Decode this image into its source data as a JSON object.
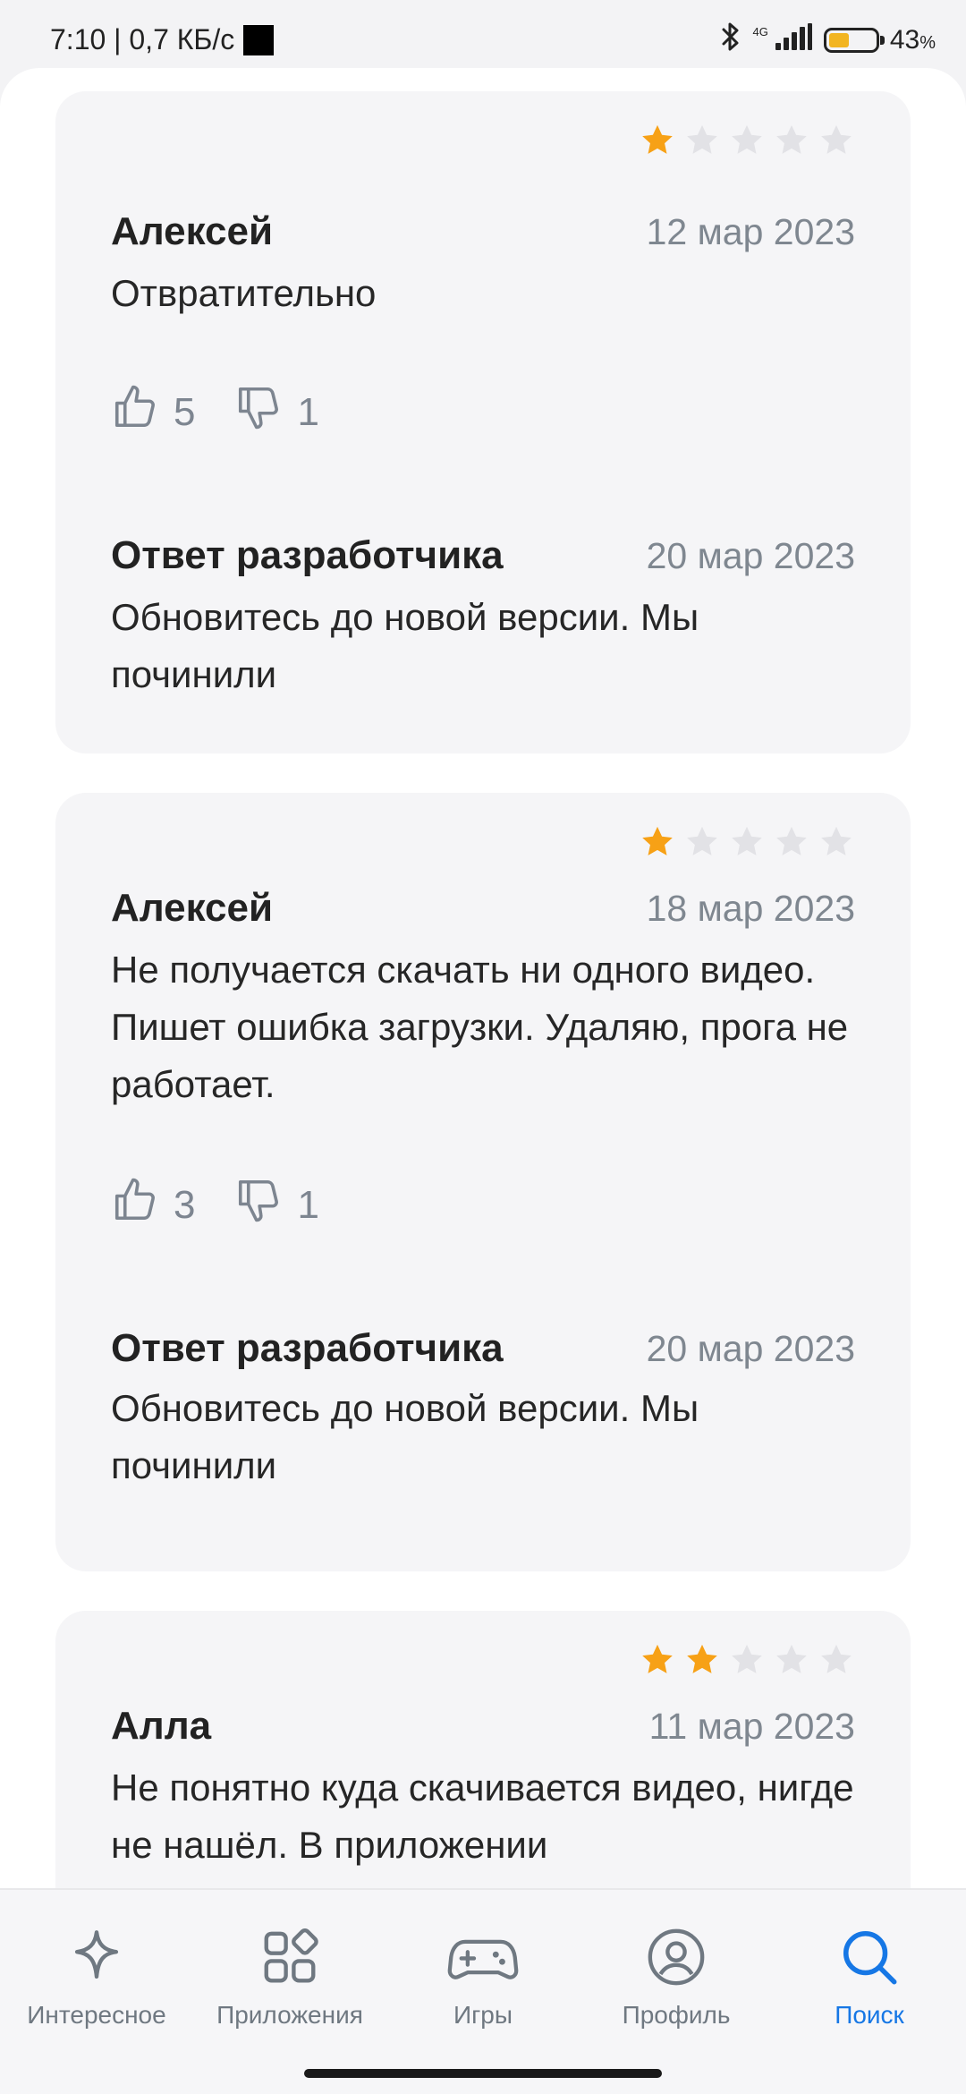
{
  "status_bar": {
    "time_speed": "7:10 | 0,7 КБ/с",
    "network": "4G",
    "battery_percent": "43",
    "battery_percent_sign": "%",
    "battery_level": 0.43
  },
  "reviews": [
    {
      "rating": 1,
      "max_rating": 5,
      "author": "Алексей",
      "date": "12 мар 2023",
      "text": "Отвратительно",
      "likes": "5",
      "dislikes": "1",
      "dev_reply": {
        "title": "Ответ разработчика",
        "date": "20 мар 2023",
        "text": "Обновитесь до новой версии. Мы починили"
      }
    },
    {
      "rating": 1,
      "max_rating": 5,
      "author": "Алексей",
      "date": "18 мар 2023",
      "text": "Не получается скачать ни одного видео. Пишет ошибка загрузки. Удаляю, прога не работает.",
      "likes": "3",
      "dislikes": "1",
      "dev_reply": {
        "title": "Ответ разработчика",
        "date": "20 мар 2023",
        "text": "Обновитесь до новой версии. Мы починили"
      }
    },
    {
      "rating": 2,
      "max_rating": 5,
      "author": "Алла",
      "date": "11 мар 2023",
      "text": "Не понятно куда скачивается видео, нигде не нашёл. В приложении"
    }
  ],
  "bottom_nav": {
    "items": [
      {
        "label": "Интересное",
        "icon": "sparkle-icon"
      },
      {
        "label": "Приложения",
        "icon": "apps-grid-icon"
      },
      {
        "label": "Игры",
        "icon": "gamepad-icon"
      },
      {
        "label": "Профиль",
        "icon": "profile-icon"
      },
      {
        "label": "Поиск",
        "icon": "search-icon",
        "active": true
      }
    ]
  },
  "colors": {
    "star_filled": "#f7a116",
    "star_empty": "#e2e2e6",
    "accent": "#1677e5",
    "muted": "#7f8790"
  }
}
